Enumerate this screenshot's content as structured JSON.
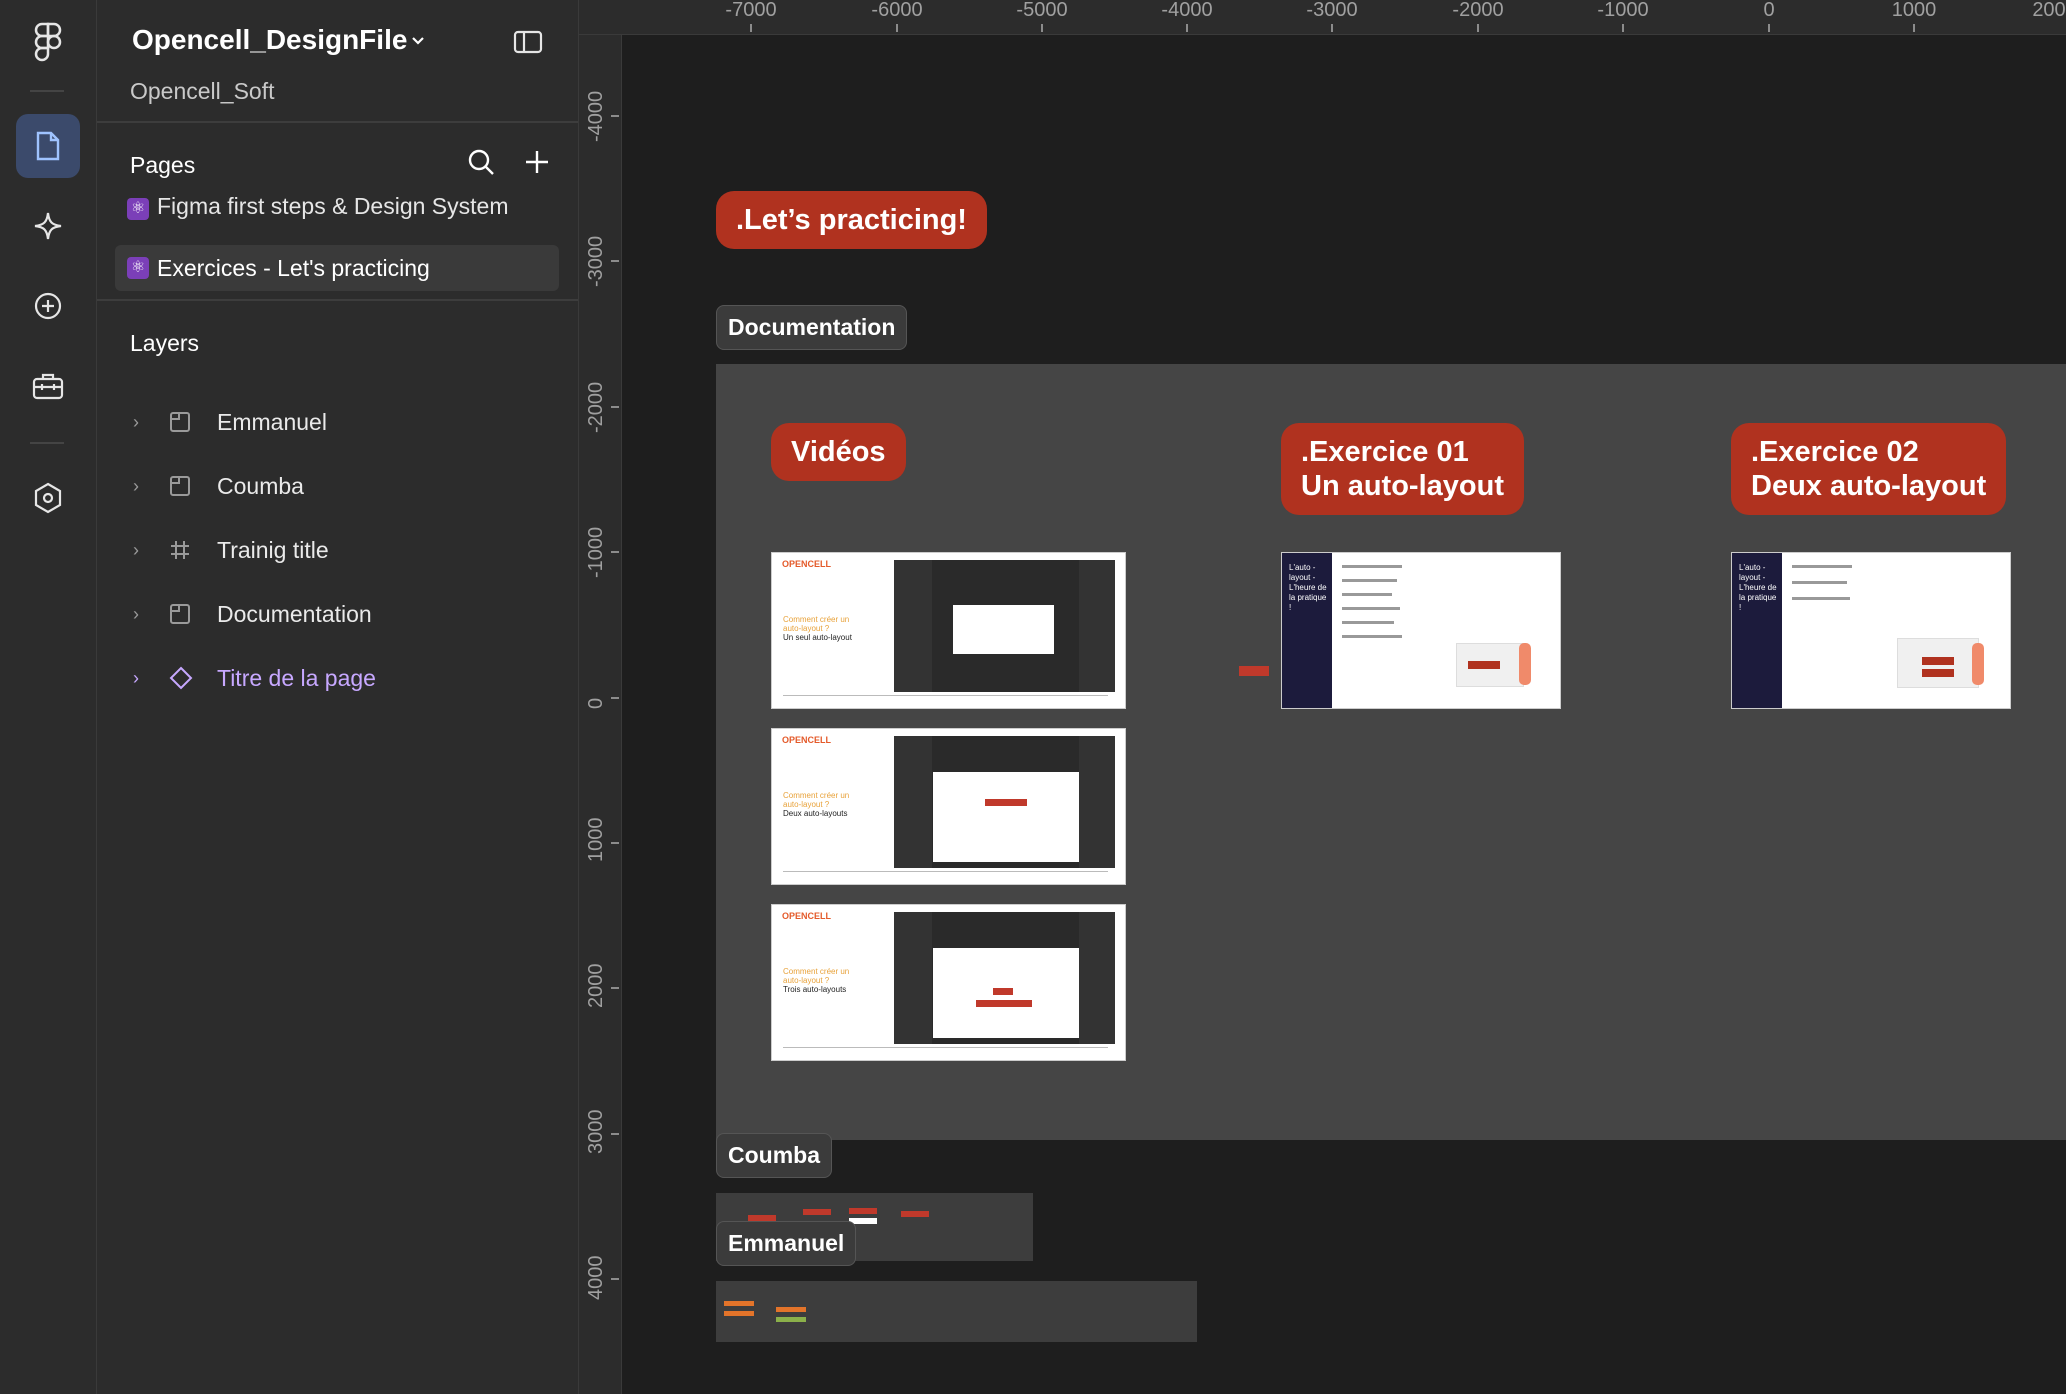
{
  "header": {
    "file_name": "Opencell_DesignFile",
    "team_name": "Opencell_Soft"
  },
  "rail": {
    "items": [
      {
        "icon": "figma-logo-icon"
      },
      {
        "icon": "file-icon",
        "active": true
      },
      {
        "icon": "sparkle-icon"
      },
      {
        "icon": "plus-circle-icon"
      },
      {
        "icon": "toolbox-icon"
      },
      {
        "icon": "hexagon-settings-icon"
      }
    ]
  },
  "pages": {
    "title": "Pages",
    "items": [
      {
        "label": "Figma first steps & Design System",
        "emoji": "⚛"
      },
      {
        "label": "Exercices - Let's practicing",
        "emoji": "⚛",
        "selected": true
      }
    ]
  },
  "layers": {
    "title": "Layers",
    "items": [
      {
        "label": "Emmanuel",
        "type": "section"
      },
      {
        "label": "Coumba",
        "type": "section"
      },
      {
        "label": "Trainig title",
        "type": "frame"
      },
      {
        "label": "Documentation",
        "type": "section"
      },
      {
        "label": "Titre de la page",
        "type": "component"
      }
    ]
  },
  "rulers": {
    "top": [
      "-7000",
      "-6000",
      "-5000",
      "-4000",
      "-3000",
      "-2000",
      "-1000",
      "0",
      "1000",
      "200"
    ],
    "left": [
      "-4000",
      "-3000",
      "-2000",
      "-1000",
      "0",
      "1000",
      "2000",
      "3000",
      "4000"
    ]
  },
  "canvas": {
    "training_title": ".Let’s practicing!",
    "doc_label": "Documentation",
    "coumba_label": "Coumba",
    "emmanuel_label": "Emmanuel",
    "videos_pill": "Vidéos",
    "ex1_pill_line1": ".Exercice 01",
    "ex1_pill_line2": "Un auto-layout",
    "ex2_pill_line1": ".Exercice 02",
    "ex2_pill_line2": "Deux auto-layout",
    "thumbs": [
      {
        "brand": "OPENCELL",
        "line1": "Comment créer un",
        "line2": "auto-layout ?",
        "line3": "Un seul auto-layout"
      },
      {
        "brand": "OPENCELL",
        "line1": "Comment créer un",
        "line2": "auto-layout ?",
        "line3": "Deux auto-layouts"
      },
      {
        "brand": "OPENCELL",
        "line1": "Comment créer un",
        "line2": "auto-layout ?",
        "line3": "Trois auto-layouts"
      }
    ],
    "ex_side_text": "L'auto - layout - L'heure de la pratique !"
  },
  "colors": {
    "accent_red": "#b0321f",
    "rail_active": "#3b4a6b",
    "component_purple": "#c7a8ff"
  }
}
